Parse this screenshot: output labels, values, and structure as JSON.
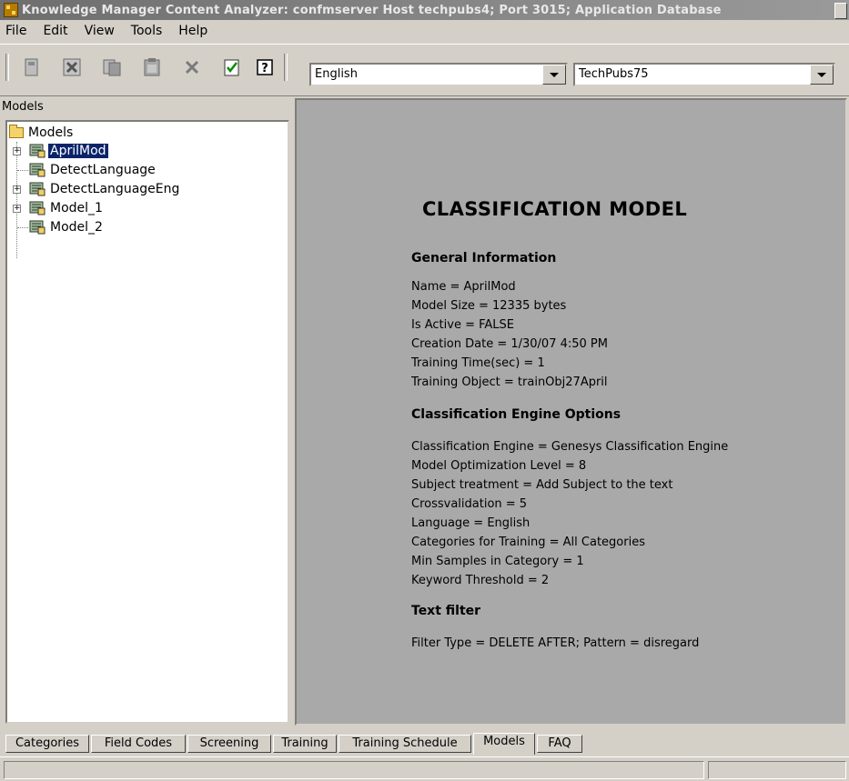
{
  "window": {
    "title": "Knowledge Manager Content Analyzer: confmserver Host techpubs4; Port 3015; Application Database"
  },
  "menubar": {
    "items": [
      {
        "label": "File"
      },
      {
        "label": "Edit"
      },
      {
        "label": "View"
      },
      {
        "label": "Tools"
      },
      {
        "label": "Help"
      }
    ]
  },
  "toolbar": {
    "buttons": [
      "new-icon",
      "cut-icon",
      "copy-icon",
      "paste-icon",
      "delete-icon",
      "check-icon",
      "help-icon"
    ],
    "language_combo": {
      "value": "English"
    },
    "database_combo": {
      "value": "TechPubs75"
    }
  },
  "left_panel": {
    "header": "Models",
    "tree": {
      "root": {
        "label": "Models",
        "icon": "folder-icon"
      },
      "items": [
        {
          "label": "AprilMod",
          "expandable": true,
          "selected": true,
          "icon": "model-icon"
        },
        {
          "label": "DetectLanguage",
          "expandable": false,
          "selected": false,
          "icon": "model-icon"
        },
        {
          "label": "DetectLanguageEng",
          "expandable": true,
          "selected": false,
          "icon": "model-icon"
        },
        {
          "label": "Model_1",
          "expandable": true,
          "selected": false,
          "icon": "model-icon"
        },
        {
          "label": "Model_2",
          "expandable": false,
          "selected": false,
          "icon": "model-icon"
        }
      ]
    }
  },
  "detail": {
    "title": "CLASSIFICATION MODEL",
    "sections": [
      {
        "heading": "General Information",
        "lines": [
          "Name = AprilMod",
          "Model Size = 12335 bytes",
          "Is Active = FALSE",
          "Creation Date = 1/30/07 4:50 PM",
          "Training Time(sec) = 1",
          "Training Object = trainObj27April"
        ]
      },
      {
        "heading": "Classification Engine Options",
        "lines": [
          "Classification Engine = Genesys Classification Engine",
          "Model Optimization Level = 8",
          "Subject treatment = Add Subject to the text",
          "Crossvalidation = 5",
          "Language = English",
          "Categories for Training = All Categories",
          "Min Samples in Category = 1",
          "Keyword Threshold = 2"
        ]
      },
      {
        "heading": "Text filter",
        "lines": [
          "Filter Type = DELETE AFTER; Pattern = disregard"
        ]
      }
    ]
  },
  "tabs": [
    {
      "label": "Categories",
      "active": false
    },
    {
      "label": "Field Codes",
      "active": false
    },
    {
      "label": "Screening",
      "active": false
    },
    {
      "label": "Training",
      "active": false
    },
    {
      "label": "Training Schedule",
      "active": false
    },
    {
      "label": "Models",
      "active": true
    },
    {
      "label": "FAQ",
      "active": false
    }
  ],
  "statusbar": {
    "text": ""
  },
  "colors": {
    "chrome": "#d4d0c8",
    "detail_background": "#a9a9a9",
    "selection": "#0a246a"
  }
}
